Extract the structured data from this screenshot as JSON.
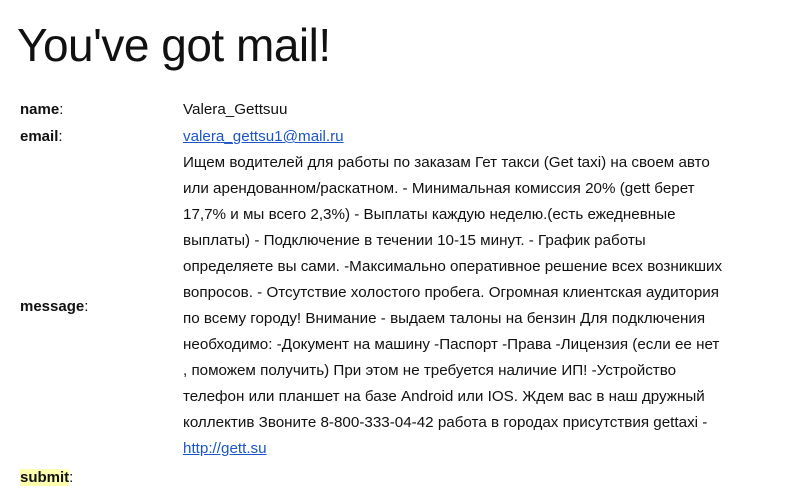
{
  "page_title": "You've got mail!",
  "fields": {
    "name_label": "name",
    "name_value": "Valera_Gettsuu",
    "email_label": "email",
    "email_value": "valera_gettsu1@mail.ru",
    "message_label": "message",
    "message_lines": [
      "Ищем водителей для работы по заказам Гет такси (Get taxi) на своем авто",
      "или арендованном/раскатном. - Минимальная комиссия 20% (gett берет",
      "17,7% и мы всего 2,3%) - Выплаты каждую неделю.(есть ежедневные",
      "выплаты) - Подключение в течении 10-15 минут. - График работы",
      "определяете вы сами. -Максимально оперативное решение всех возникших",
      "вопросов. - Отсутствие холостого пробега. Огромная клиентская аудитория",
      "по всему городу! Внимание - выдаем талоны на бензин Для подключения",
      "необходимо: -Документ на машину -Паспорт -Права -Лицензия (если ее нет",
      ", поможем получить) При этом не требуется наличие ИП! -Устройство",
      "телефон или планшет на базе Android или IOS. Ждем вас в наш дружный",
      "коллектив Звоните 8-800-333-04-42 работа в городах присутствия gettaxi -"
    ],
    "message_link": "http://gett.su",
    "submit_label": "submit",
    "colon": ":"
  },
  "colors": {
    "link": "#1a55c9",
    "highlight": "#ffffb0",
    "text": "#111111"
  }
}
